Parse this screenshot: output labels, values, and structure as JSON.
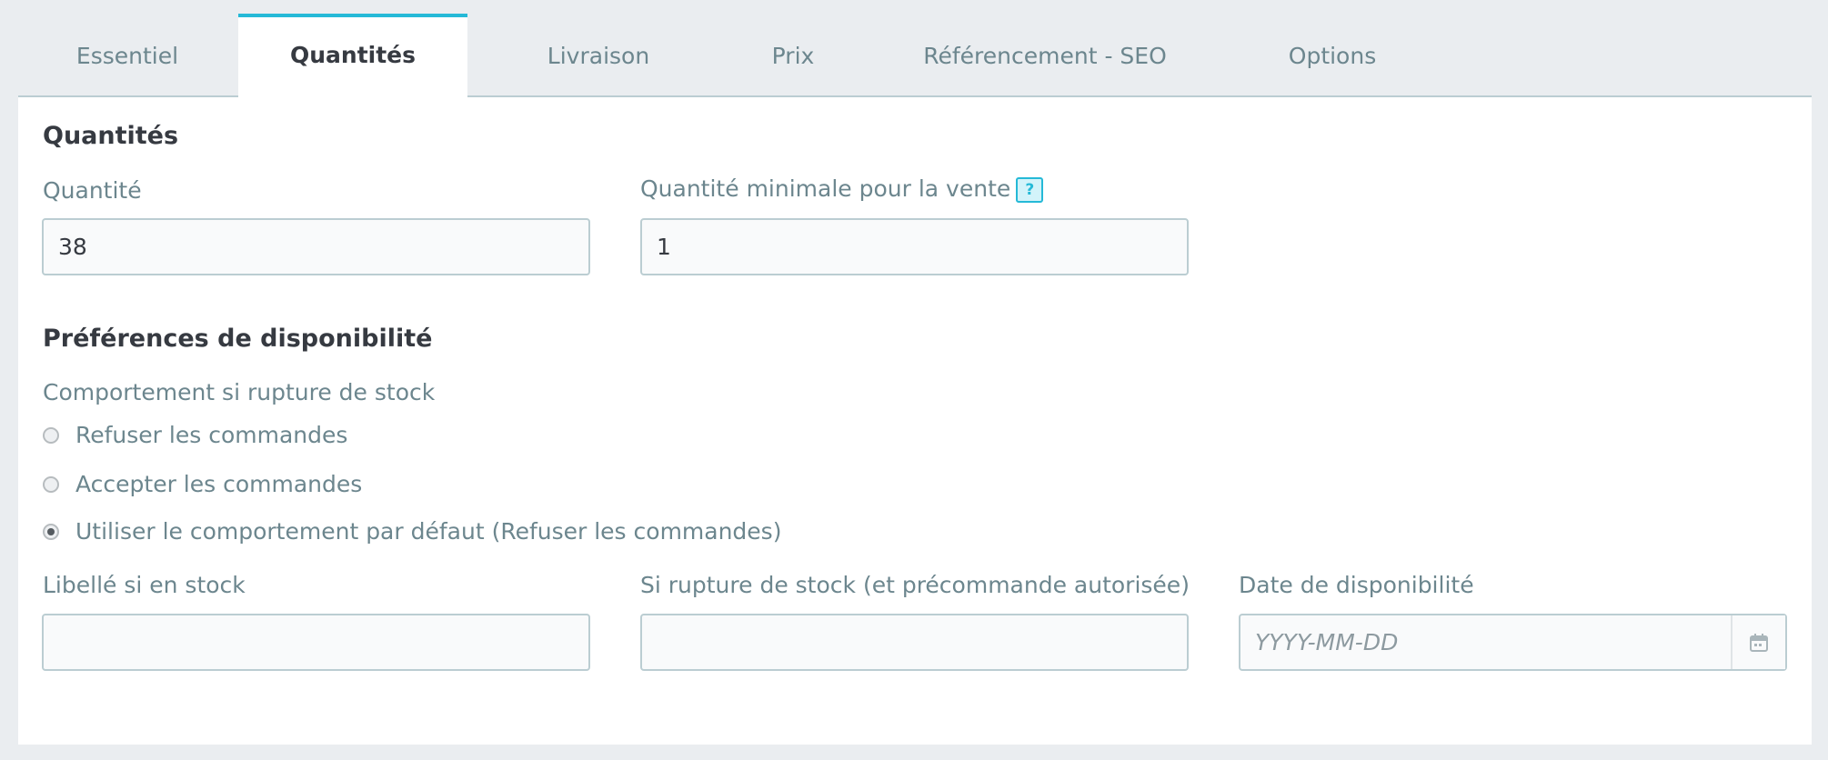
{
  "tabs": [
    {
      "label": "Essentiel"
    },
    {
      "label": "Quantités",
      "active": true
    },
    {
      "label": "Livraison"
    },
    {
      "label": "Prix"
    },
    {
      "label": "Référencement - SEO"
    },
    {
      "label": "Options"
    }
  ],
  "quantities": {
    "title": "Quantités",
    "quantity_label": "Quantité",
    "quantity_value": "38",
    "min_qty_label": "Quantité minimale pour la vente",
    "min_qty_help": "?",
    "min_qty_value": "1"
  },
  "availability": {
    "title": "Préférences de disponibilité",
    "out_of_stock_label": "Comportement si rupture de stock",
    "options": [
      {
        "label": "Refuser les commandes",
        "checked": false
      },
      {
        "label": "Accepter les commandes",
        "checked": false
      },
      {
        "label": "Utiliser le comportement par défaut (Refuser les commandes)",
        "checked": true
      }
    ],
    "in_stock_label": "Libellé si en stock",
    "in_stock_value": "",
    "backorder_label": "Si rupture de stock (et précommande autorisée)",
    "backorder_value": "",
    "date_label": "Date de disponibilité",
    "date_placeholder": "YYYY-MM-DD",
    "date_icon": "calendar-icon"
  },
  "colors": {
    "accent": "#25b9d7",
    "background": "#eaedf0",
    "panel": "#ffffff",
    "label": "#6c868e"
  }
}
